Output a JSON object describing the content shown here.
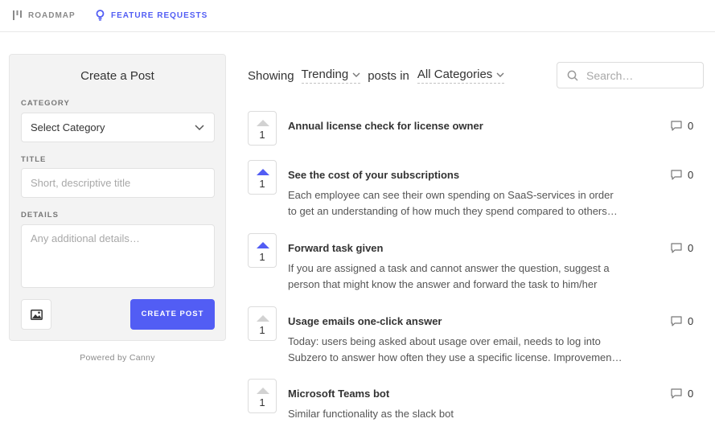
{
  "nav": {
    "roadmap_label": "ROADMAP",
    "features_label": "FEATURE REQUESTS",
    "active_color": "#525df4"
  },
  "create_post": {
    "title": "Create a Post",
    "category_label": "CATEGORY",
    "category_value": "Select Category",
    "title_label": "TITLE",
    "title_placeholder": "Short, descriptive title",
    "details_label": "DETAILS",
    "details_placeholder": "Any additional details…",
    "submit_label": "CREATE POST",
    "powered_by": "Powered by Canny"
  },
  "filters": {
    "showing_label": "Showing",
    "sort_value": "Trending",
    "posts_in_label": "posts in",
    "category_value": "All Categories",
    "search_placeholder": "Search…"
  },
  "posts": [
    {
      "title": "Annual license check for license owner",
      "lines": [],
      "votes": "1",
      "voted": false,
      "comments": "0"
    },
    {
      "title": "See the cost of your subscriptions",
      "lines": [
        "Each employee can see their own spending on SaaS-services in order",
        "to get an understanding of how much they spend compared to others…"
      ],
      "votes": "1",
      "voted": true,
      "comments": "0"
    },
    {
      "title": "Forward task given",
      "lines": [
        "If you are assigned a task and cannot answer the question, suggest a",
        "person that might know the answer and forward the task to him/her"
      ],
      "votes": "1",
      "voted": true,
      "comments": "0"
    },
    {
      "title": "Usage emails one-click answer",
      "lines": [
        "Today: users being asked about usage over email, needs to log into",
        "Subzero to answer how often they use a specific license. Improvemen…"
      ],
      "votes": "1",
      "voted": false,
      "comments": "0"
    },
    {
      "title": "Microsoft Teams bot",
      "lines": [
        "Similar functionality as the slack bot"
      ],
      "votes": "1",
      "voted": false,
      "comments": "0"
    }
  ]
}
